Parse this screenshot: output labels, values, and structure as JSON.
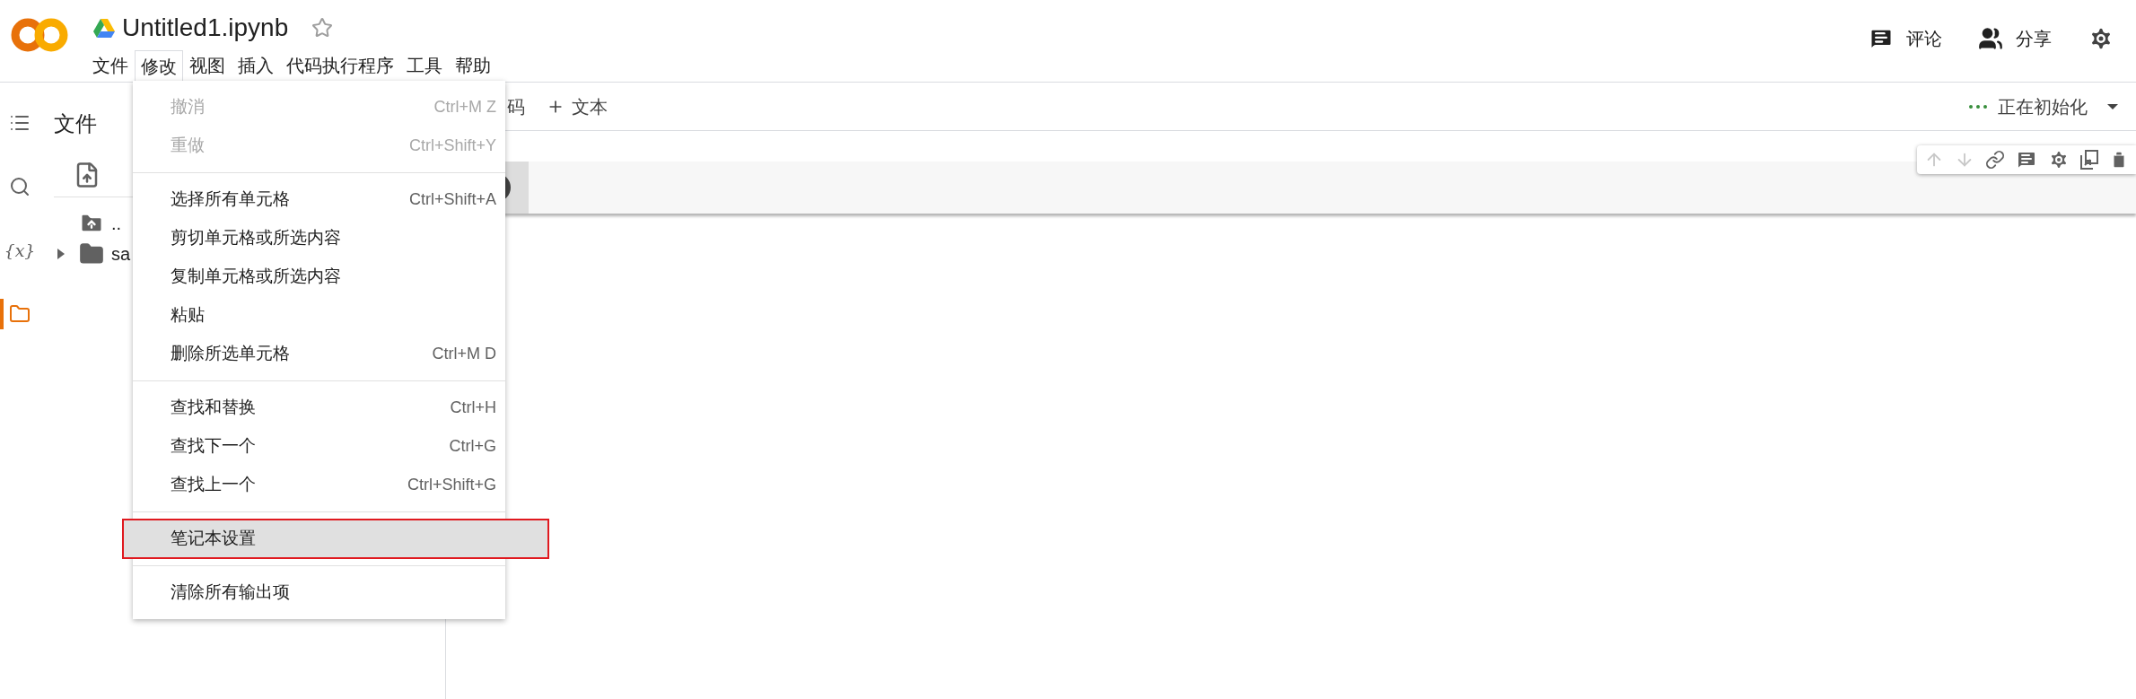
{
  "header": {
    "title": "Untitled1.ipynb",
    "starred": false,
    "menus": [
      {
        "label": "文件",
        "selected": false
      },
      {
        "label": "修改",
        "selected": true
      },
      {
        "label": "视图",
        "selected": false
      },
      {
        "label": "插入",
        "selected": false
      },
      {
        "label": "代码执行程序",
        "selected": false
      },
      {
        "label": "工具",
        "selected": false
      },
      {
        "label": "帮助",
        "selected": false
      }
    ],
    "actions": [
      {
        "kind": "comment",
        "label": "评论"
      },
      {
        "kind": "share",
        "label": "分享"
      }
    ]
  },
  "sidebar": {
    "items": [
      {
        "kind": "toc",
        "selected": false
      },
      {
        "kind": "search",
        "selected": false
      },
      {
        "kind": "variables",
        "label": "{x}",
        "selected": false
      },
      {
        "kind": "files",
        "selected": true
      }
    ]
  },
  "files_panel": {
    "title": "文件",
    "tree": [
      {
        "kind": "parent",
        "name": ".."
      },
      {
        "kind": "folder",
        "name": "sa",
        "expanded": false
      }
    ]
  },
  "toolbar": {
    "add_code": "码",
    "add_text": "文本",
    "status": "正在初始化"
  },
  "edit_menu": {
    "groups": [
      [
        {
          "label": "撤消",
          "shortcut": "Ctrl+M Z",
          "disabled": true,
          "selected": false
        },
        {
          "label": "重做",
          "shortcut": "Ctrl+Shift+Y",
          "disabled": true,
          "selected": false
        }
      ],
      [
        {
          "label": "选择所有单元格",
          "shortcut": "Ctrl+Shift+A",
          "disabled": false,
          "selected": false
        },
        {
          "label": "剪切单元格或所选内容",
          "disabled": false,
          "selected": false
        },
        {
          "label": "复制单元格或所选内容",
          "disabled": false,
          "selected": false
        },
        {
          "label": "粘贴",
          "disabled": false,
          "selected": false
        },
        {
          "label": "删除所选单元格",
          "shortcut": "Ctrl+M D",
          "disabled": false,
          "selected": false
        }
      ],
      [
        {
          "label": "查找和替换",
          "shortcut": "Ctrl+H",
          "disabled": false,
          "selected": false
        },
        {
          "label": "查找下一个",
          "shortcut": "Ctrl+G",
          "disabled": false,
          "selected": false
        },
        {
          "label": "查找上一个",
          "shortcut": "Ctrl+Shift+G",
          "disabled": false,
          "selected": false
        }
      ],
      [
        {
          "label": "笔记本设置",
          "disabled": false,
          "selected": true
        }
      ],
      [
        {
          "label": "清除所有输出项",
          "disabled": false,
          "selected": false
        }
      ]
    ]
  }
}
